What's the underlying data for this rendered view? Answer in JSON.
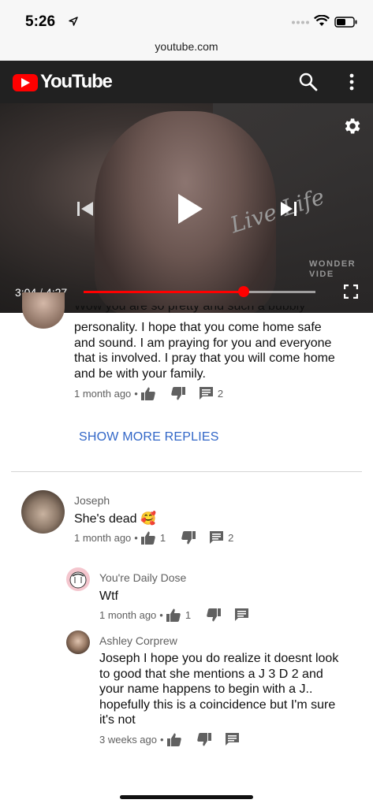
{
  "status_bar": {
    "time": "5:26"
  },
  "browser": {
    "url": "youtube.com"
  },
  "header": {
    "brand": "YouTube"
  },
  "player": {
    "current_time": "3:04",
    "separator": "/",
    "duration": "4:27",
    "progress_fraction": 0.689,
    "overlay_text": "Live Life",
    "watermark_line1": "WONDER",
    "watermark_line2": "VIDE"
  },
  "partial_reply": {
    "text_top_clipped": "Wow you are so pretty and such a bubbly",
    "text": "personality. I hope that you come home safe and sound. I am praying for you and everyone that is involved. I pray that you will come home and be with your family.",
    "time": "1 month ago",
    "likes": "",
    "replies": "2"
  },
  "show_more_replies": "SHOW MORE REPLIES",
  "comment": {
    "author": "Joseph",
    "text": "She's dead 🥰",
    "time": "1 month ago",
    "likes": "1",
    "replies": "2"
  },
  "replies": [
    {
      "author": "You're Daily Dose",
      "text": "Wtf",
      "time": "1 month ago",
      "likes": "1"
    },
    {
      "author": "Ashley Corprew",
      "text": "Joseph I hope you do realize it doesnt look to good that she mentions a J 3 D 2 and your name happens to begin with a J.. hopefully this is a coincidence but I'm sure it's not",
      "time": "3 weeks ago",
      "likes": ""
    }
  ],
  "colors": {
    "accent_red": "#ff0000",
    "link_blue": "#3166c7",
    "meta_gray": "#606060",
    "header_bg": "#212121"
  },
  "icons": [
    "location-arrow-icon",
    "wifi-icon",
    "battery-icon",
    "search-icon",
    "more-vert-icon",
    "settings-icon",
    "previous-icon",
    "play-icon",
    "next-icon",
    "fullscreen-icon",
    "thumb-up-icon",
    "thumb-down-icon",
    "reply-icon"
  ]
}
